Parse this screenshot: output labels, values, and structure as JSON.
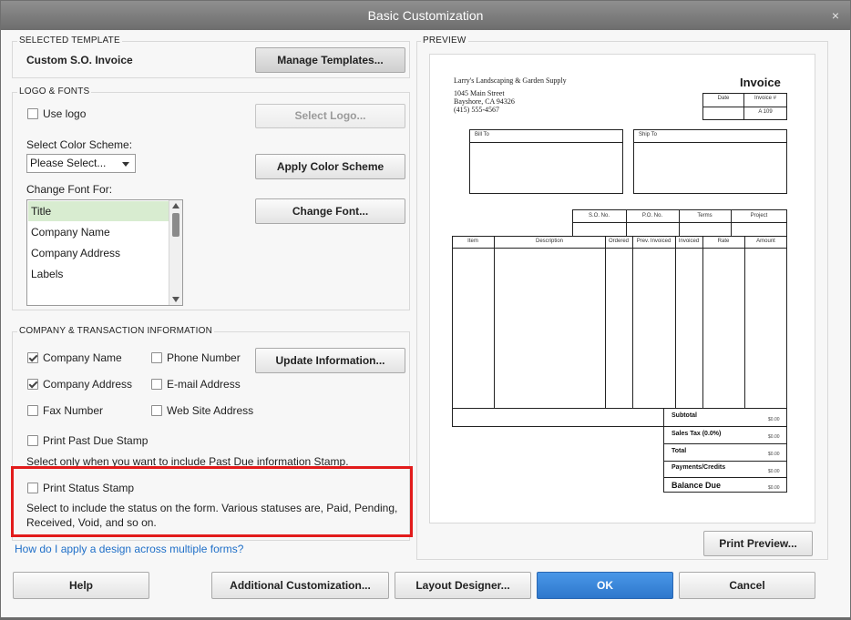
{
  "window": {
    "title": "Basic Customization",
    "close_glyph": "×"
  },
  "selected_template": {
    "section_title": "SELECTED TEMPLATE",
    "name": "Custom S.O. Invoice",
    "manage_btn": "Manage Templates..."
  },
  "logo_fonts": {
    "section_title": "LOGO & FONTS",
    "use_logo": "Use logo",
    "select_logo_btn": "Select Logo...",
    "color_scheme_label": "Select Color Scheme:",
    "color_scheme_value": "Please Select...",
    "apply_color_btn": "Apply Color Scheme",
    "change_font_for_label": "Change Font For:",
    "font_items": [
      "Title",
      "Company Name",
      "Company Address",
      "Labels"
    ],
    "change_font_btn": "Change Font..."
  },
  "company_info": {
    "section_title": "COMPANY & TRANSACTION INFORMATION",
    "company_name": "Company Name",
    "phone_number": "Phone Number",
    "update_btn": "Update Information...",
    "company_address": "Company Address",
    "email_address": "E-mail Address",
    "fax_number": "Fax Number",
    "website_address": "Web Site Address",
    "print_past_due": "Print Past Due Stamp",
    "past_due_note": "Select only when you want to include Past Due information Stamp.",
    "print_status": "Print Status Stamp",
    "status_note_line1": "Select to include the status on the form. Various statuses are, Paid, Pending,",
    "status_note_line2": "Received, Void, and so on."
  },
  "help_link": "How do I apply a design across multiple forms?",
  "preview": {
    "section_title": "PREVIEW",
    "company": "Larry's Landscaping & Garden Supply",
    "address1": "1045 Main Street",
    "address2": "Bayshore, CA 94326",
    "phone": "(415) 555-4567",
    "doc_title": "Invoice",
    "date_hdr": "Date",
    "invoice_no_hdr": "Invoice #",
    "invoice_no": "A 109",
    "bill_to": "Bill To",
    "ship_to": "Ship To",
    "so_no": "S.O. No.",
    "po_no": "P.O. No.",
    "terms": "Terms",
    "project": "Project",
    "columns": [
      "Item",
      "Description",
      "Ordered",
      "Prev. Invoiced",
      "Invoiced",
      "Rate",
      "Amount"
    ],
    "totals": [
      {
        "label": "Subtotal",
        "amount": "$0.00"
      },
      {
        "label": "Sales Tax  (0.0%)",
        "amount": "$0.00"
      },
      {
        "label": "Total",
        "amount": "$0.00"
      },
      {
        "label": "Payments/Credits",
        "amount": "$0.00"
      },
      {
        "label": "Balance Due",
        "amount": "$0.00"
      }
    ],
    "print_preview_btn": "Print Preview..."
  },
  "footer": {
    "help": "Help",
    "additional": "Additional Customization...",
    "layout_designer": "Layout Designer...",
    "ok": "OK",
    "cancel": "Cancel"
  },
  "checkbox_states": {
    "use_logo": false,
    "company_name": true,
    "phone_number": false,
    "company_address": true,
    "email_address": false,
    "fax_number": false,
    "website_address": false,
    "print_past_due": false,
    "print_status": false
  },
  "colors": {
    "highlight_red": "#e21b1b",
    "link_blue": "#1f6fc8",
    "ok_blue": "#3582d8",
    "selected_item": "#d8ecd0"
  }
}
